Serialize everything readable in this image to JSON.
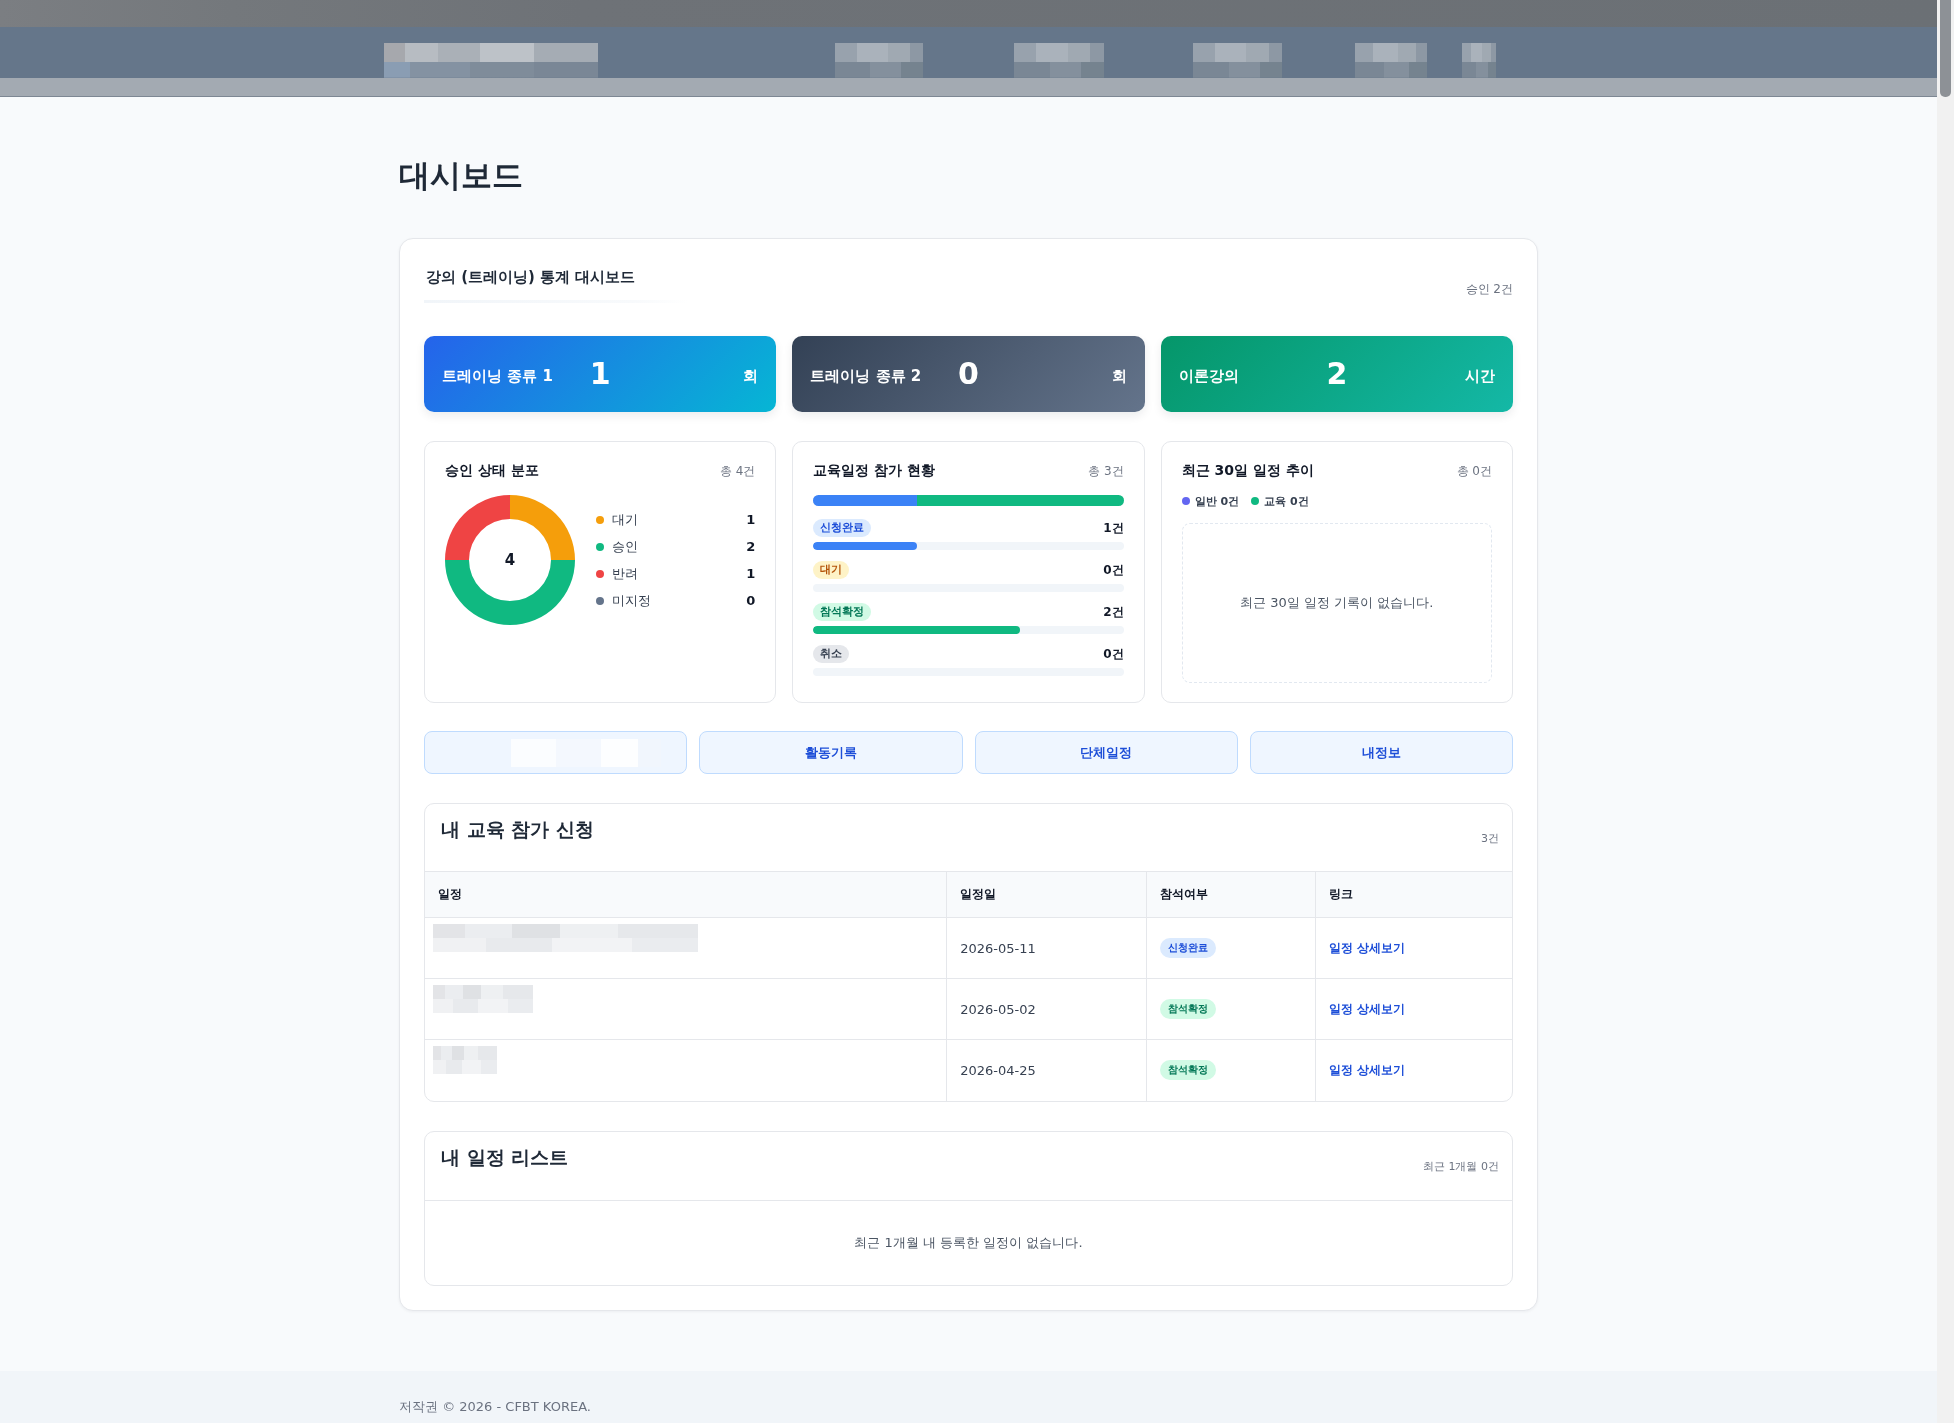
{
  "header": {
    "logo": {
      "redacted": true
    },
    "menu": [
      {
        "redacted": true
      },
      {
        "redacted": true
      },
      {
        "redacted": true
      },
      {
        "redacted": true
      },
      {
        "redacted": true
      }
    ]
  },
  "page_title": "대시보드",
  "dashboard": {
    "title": "강의 (트레이닝) 통계 대시보드",
    "summary": "승인 2건",
    "stat_cards": [
      {
        "kind": "blue",
        "label": "트레이닝 종류 1",
        "value": "1",
        "unit": "회"
      },
      {
        "kind": "slate",
        "label": "트레이닝 종류 2",
        "value": "0",
        "unit": "회"
      },
      {
        "kind": "green",
        "label": "이론강의",
        "value": "2",
        "unit": "시간"
      }
    ],
    "approval": {
      "title": "승인 상태 분포",
      "total": "총 4건",
      "center_label": "4",
      "chart_data": {
        "type": "donut",
        "categories": [
          "대기",
          "승인",
          "반려",
          "미지정"
        ],
        "values": [
          25,
          50,
          25,
          0
        ]
      },
      "legend": [
        {
          "value": "1",
          "color": "#f59e0b"
        },
        {
          "value": "2",
          "color": "#10b981"
        },
        {
          "value": "1",
          "color": "#ef4444"
        },
        {
          "value": "0",
          "color": "#64748b"
        }
      ]
    },
    "participation": {
      "title": "교육일정 참가 현황",
      "total": "총 3건",
      "rows": [
        {
          "kind": "applied",
          "label": "신청완료",
          "count": "1건",
          "level": 0.333
        },
        {
          "kind": "pending",
          "label": "대기",
          "count": "0건"
        },
        {
          "kind": "confirmed",
          "label": "참석확정",
          "count": "2건",
          "level": 0.667
        },
        {
          "kind": "cancelled",
          "label": "취소",
          "count": "0건"
        }
      ]
    },
    "trend": {
      "title": "최근 30일 일정 추이",
      "total": "총 0건",
      "legend": [
        {
          "label": "일반 0건",
          "color": "#6366f1"
        },
        {
          "label": "교육 0건",
          "color": "#10b981"
        }
      ],
      "empty_message": "최근 30일 일정 기록이 없습니다."
    },
    "quick_links": [
      {
        "redacted": true
      },
      {
        "label": "활동기록",
        "redacted": false
      },
      {
        "label": "단체일정",
        "redacted": false
      },
      {
        "label": "내정보",
        "redacted": false
      }
    ],
    "applications": {
      "title": "내 교육 참가 신청",
      "count": "3건",
      "columns": [
        "일정",
        "일정일",
        "참석여부",
        "링크"
      ],
      "rows": [
        {
          "schedule": {
            "redacted": true
          },
          "date": "2026-05-11",
          "status": {
            "kind": "applied",
            "label": "신청완료"
          },
          "link": "일정 상세보기"
        },
        {
          "schedule": {
            "redacted": true
          },
          "date": "2026-05-02",
          "status": {
            "kind": "confirmed",
            "label": "참석확정"
          },
          "link": "일정 상세보기"
        },
        {
          "schedule": {
            "redacted": true
          },
          "date": "2026-04-25",
          "status": {
            "kind": "confirmed",
            "label": "참석확정"
          },
          "link": "일정 상세보기"
        }
      ]
    },
    "my_schedule": {
      "title": "내 일정 리스트",
      "count": "최근 1개월 0건",
      "empty_message": "최근 1개월 내 등록한 일정이 없습니다."
    }
  },
  "footer": {
    "text": "저작권 © 2026 - CFBT KOREA."
  }
}
